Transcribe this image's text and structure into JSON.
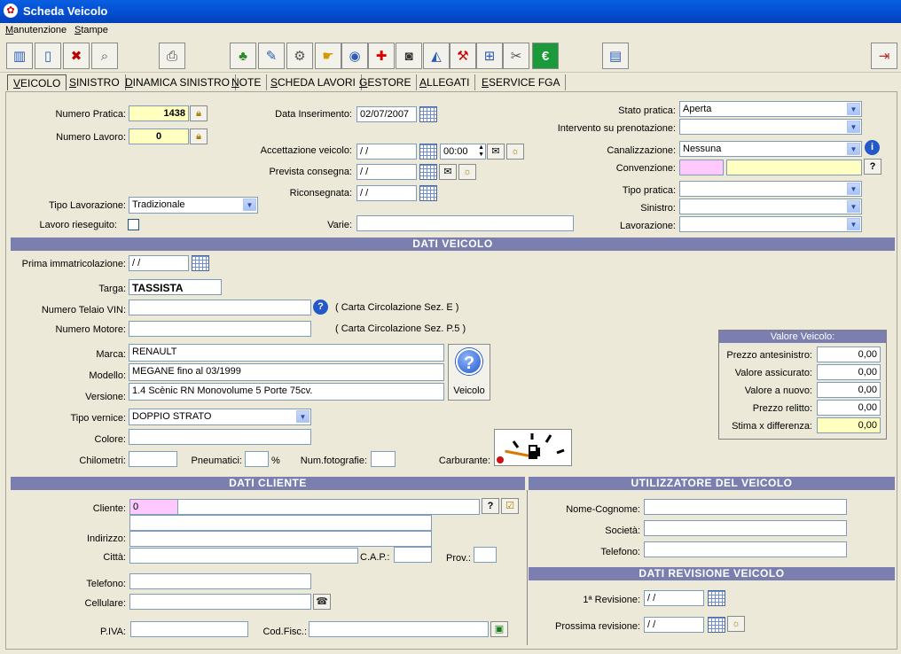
{
  "window": {
    "title": "Scheda Veicolo",
    "app_icon": "app-icon"
  },
  "menu": {
    "items": [
      "Manutenzione",
      "Stampe"
    ]
  },
  "toolbar": {
    "buttons": [
      "list-icon",
      "new-document-icon",
      "delete-icon",
      "search-icon",
      "print-icon",
      "tree-icon",
      "edit-icon",
      "car-lift-icon",
      "hand-icon",
      "car-icon",
      "first-aid-icon",
      "camera-icon",
      "scanner-icon",
      "tools-icon",
      "cart-icon",
      "wrench-icon",
      "euro-icon",
      "payment-card-icon",
      "exit-icon"
    ]
  },
  "tabs": [
    "VEICOLO",
    "SINISTRO",
    "DINAMICA SINISTRO",
    "NOTE",
    "SCHEDA LAVORI",
    "GESTORE",
    "ALLEGATI",
    "ESERVICE FGA"
  ],
  "pratica": {
    "numero_pratica_label": "Numero Pratica:",
    "numero_pratica": "1438",
    "numero_lavoro_label": "Numero Lavoro:",
    "numero_lavoro": "0",
    "tipo_lavorazione_label": "Tipo Lavorazione:",
    "tipo_lavorazione": "Tradizionale",
    "lavoro_rieseguito_label": "Lavoro rieseguito:"
  },
  "date": {
    "data_inserimento_label": "Data Inserimento:",
    "data_inserimento": "02/07/2007",
    "accettazione_label": "Accettazione veicolo:",
    "accettazione": "  /  /",
    "accettazione_ora": "00:00",
    "prevista_label": "Prevista consegna:",
    "prevista": "  /  /",
    "riconsegnata_label": "Riconsegnata:",
    "riconsegnata": "  /  /",
    "varie_label": "Varie:",
    "varie": ""
  },
  "stato": {
    "stato_pratica_label": "Stato pratica:",
    "stato_pratica": "Aperta",
    "intervento_label": "Intervento su prenotazione:",
    "intervento": "",
    "canalizzazione_label": "Canalizzazione:",
    "canalizzazione": "Nessuna",
    "convenzione_label": "Convenzione:",
    "convenzione_code": "",
    "convenzione_desc": "",
    "tipo_pratica_label": "Tipo pratica:",
    "tipo_pratica": "",
    "sinistro_label": "Sinistro:",
    "sinistro": "",
    "lavorazione_label": "Lavorazione:",
    "lavorazione": ""
  },
  "sections": {
    "dati_veicolo": "DATI  VEICOLO",
    "dati_cliente": "DATI  CLIENTE",
    "utilizzatore": "UTILIZZATORE  DEL  VEICOLO",
    "revisione": "DATI REVISIONE VEICOLO"
  },
  "veicolo": {
    "prima_imm_label": "Prima immatricolazione:",
    "prima_imm": "  /  /",
    "targa_label": "Targa:",
    "targa": "TASSISTA",
    "telaio_label": "Numero Telaio VIN:",
    "telaio": "",
    "telaio_note": "( Carta Circolazione Sez. E )",
    "motore_label": "Numero Motore:",
    "motore": "",
    "motore_note": "( Carta Circolazione Sez. P.5 )",
    "marca_label": "Marca:",
    "marca": "RENAULT",
    "modello_label": "Modello:",
    "modello": "MEGANE fino al 03/1999",
    "versione_label": "Versione:",
    "versione": "1.4 Scènic RN Monovolume 5 Porte 75cv.",
    "veicolo_btn": "Veicolo",
    "vernice_label": "Tipo vernice:",
    "vernice": "DOPPIO STRATO",
    "colore_label": "Colore:",
    "colore": "",
    "km_label": "Chilometri:",
    "km": "",
    "pneumatici_label": "Pneumatici:",
    "pneumatici": "",
    "percent": "%",
    "num_foto_label": "Num.fotografie:",
    "num_foto": "",
    "carburante_label": "Carburante:",
    "carburante_level": 0.1
  },
  "valore": {
    "title": "Valore Veicolo:",
    "rows": [
      {
        "label": "Prezzo antesinistro:",
        "value": "0,00"
      },
      {
        "label": "Valore assicurato:",
        "value": "0,00"
      },
      {
        "label": "Valore a nuovo:",
        "value": "0,00"
      },
      {
        "label": "Prezzo relitto:",
        "value": "0,00"
      },
      {
        "label": "Stima x differenza:",
        "value": "0,00"
      }
    ]
  },
  "cliente": {
    "cliente_label": "Cliente:",
    "cliente_code": "0",
    "cliente_name": "",
    "indirizzo_label": "Indirizzo:",
    "indirizzo1": "",
    "indirizzo2": "",
    "citta_label": "Città:",
    "citta": "",
    "cap_label": "C.A.P.:",
    "cap": "",
    "prov_label": "Prov.:",
    "prov": "",
    "telefono_label": "Telefono:",
    "telefono": "",
    "cellulare_label": "Cellulare:",
    "cellulare": "",
    "piva_label": "P.IVA:",
    "piva": "",
    "codfisc_label": "Cod.Fisc.:",
    "codfisc": ""
  },
  "utilizzatore": {
    "nome_label": "Nome-Cognome:",
    "nome": "",
    "societa_label": "Società:",
    "societa": "",
    "telefono_label": "Telefono:",
    "telefono": ""
  },
  "revisione": {
    "prima_label": "1ª Revisione:",
    "prima": "  /  /",
    "prossima_label": "Prossima revisione:",
    "prossima": "  /  /"
  }
}
